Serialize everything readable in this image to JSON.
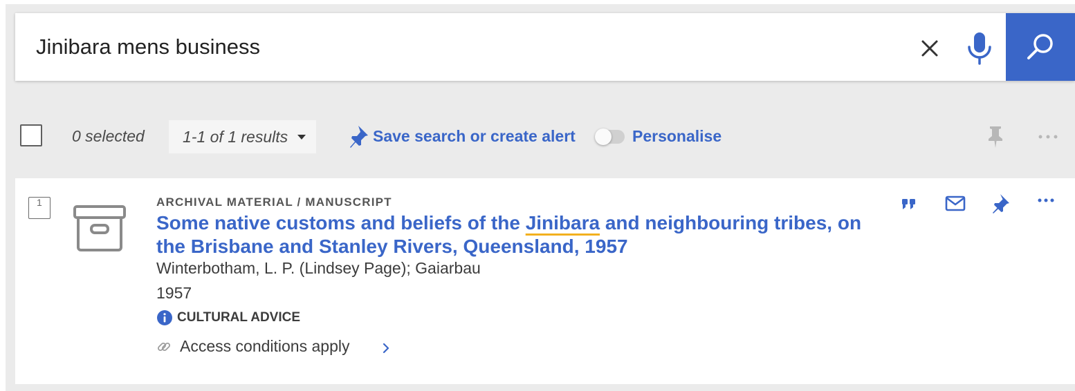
{
  "search": {
    "query": "Jinibara mens business"
  },
  "toolbar": {
    "selected_count": "0 selected",
    "results_range": "1-1 of 1 results",
    "save_search_label": "Save search or create alert",
    "personalise_label": "Personalise",
    "personalise_enabled": false
  },
  "results": [
    {
      "index": "1",
      "type": "ARCHIVAL MATERIAL / MANUSCRIPT",
      "title_before": "Some native customs and beliefs of the ",
      "title_highlight": "Jinibara",
      "title_after": " and neighbouring tribes, on the Brisbane and Stanley Rivers, Queensland, 1957",
      "creators": "Winterbotham, L. P. (Lindsey Page); Gaiarbau",
      "year": "1957",
      "cultural_advice": "CULTURAL ADVICE",
      "access": "Access conditions apply"
    }
  ],
  "icons": {
    "clear": "close-icon",
    "voice": "microphone-icon",
    "search": "search-icon",
    "save": "pin-icon",
    "more": "more-horizontal-icon",
    "resource_type": "archive-box-icon",
    "cite": "quote-icon",
    "email": "envelope-icon",
    "info": "info-icon",
    "link": "link-icon",
    "chevron": "chevron-right-icon"
  },
  "colors": {
    "accent": "#3a66c8",
    "highlight_underline": "#f2b01e",
    "page_background": "#ebebeb"
  }
}
